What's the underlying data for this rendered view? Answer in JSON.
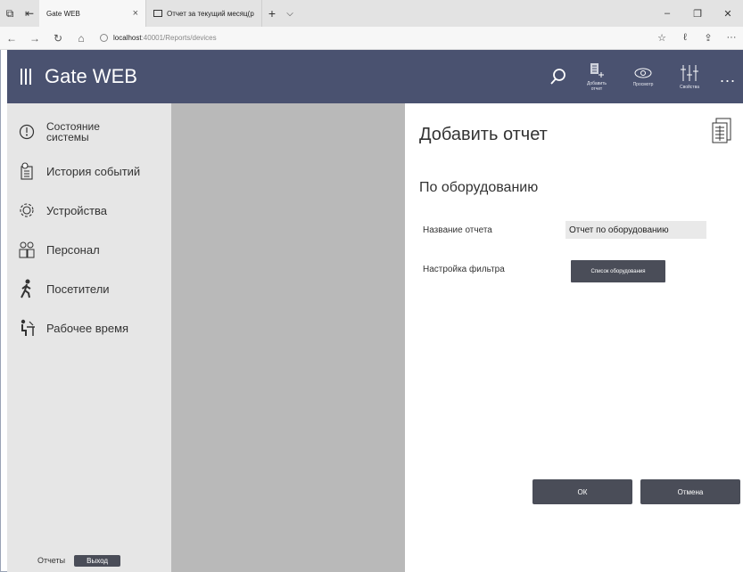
{
  "browser": {
    "tabs": [
      {
        "title": "Gate WEB",
        "close": "×"
      },
      {
        "title": "Отчет за текущий месяц(р"
      }
    ],
    "new_tab": "+",
    "tab_list": "⌵",
    "window_controls": {
      "minimize": "–",
      "maximize": "❐",
      "close": "✕"
    },
    "nav": {
      "back": "←",
      "forward": "→",
      "refresh": "↻",
      "home": "⌂"
    },
    "url_host": "localhost",
    "url_path": ":40001/Reports/devices",
    "toolbar": {
      "favorites": "☆",
      "reading": "ℓ",
      "share": "⇪",
      "more": "···"
    }
  },
  "app": {
    "title": "Gate WEB",
    "toolbar": {
      "add_report_label_1": "Добавить",
      "add_report_label_2": "отчет",
      "preview_label": "Просмотр",
      "properties_label": "Свойства",
      "more": "..."
    }
  },
  "sidebar": {
    "items": [
      {
        "label": "Состояние системы",
        "line1": "Состояние",
        "line2": "системы",
        "icon": "gauge-icon"
      },
      {
        "label": "История событий",
        "icon": "history-icon"
      },
      {
        "label": "Устройства",
        "icon": "gear-icon"
      },
      {
        "label": "Персонал",
        "icon": "personnel-icon"
      },
      {
        "label": "Посетители",
        "icon": "visitor-icon"
      },
      {
        "label": "Рабочее время",
        "icon": "worktime-icon"
      }
    ],
    "footer": {
      "reports": "Отчеты",
      "logout": "Выход"
    }
  },
  "panel": {
    "title": "Добавить отчет",
    "section": "По оборудованию",
    "name_label": "Название отчета",
    "name_value": "Отчет по оборудованию",
    "filter_label": "Настройка фильтра",
    "filter_button": "Список оборудования",
    "ok": "ОК",
    "cancel": "Отмена"
  },
  "colors": {
    "header_bg": "#4a5270",
    "sidebar_bg": "#e6e6e6",
    "middle_bg": "#b9b9b9",
    "button_bg": "#4a4d58"
  }
}
